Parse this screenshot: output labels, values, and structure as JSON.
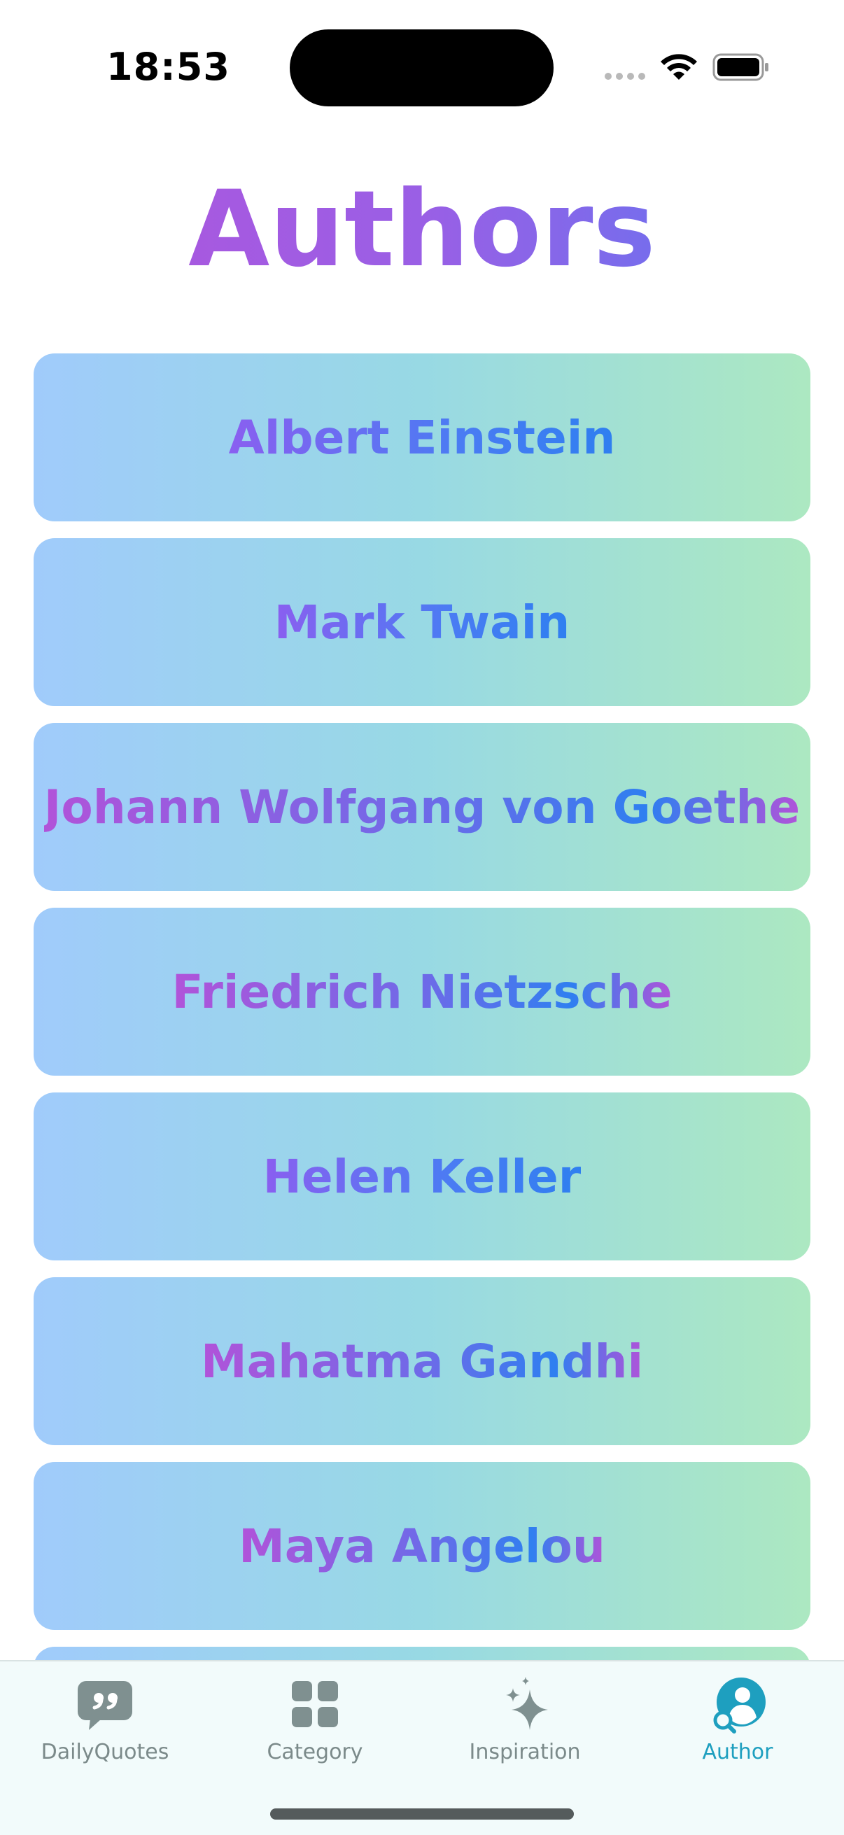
{
  "status_bar": {
    "time": "18:53"
  },
  "title": "Authors",
  "authors": [
    {
      "name": "Albert Einstein"
    },
    {
      "name": "Mark Twain"
    },
    {
      "name": "Johann Wolfgang von Goethe"
    },
    {
      "name": "Friedrich Nietzsche"
    },
    {
      "name": "Helen Keller"
    },
    {
      "name": "Mahatma Gandhi"
    },
    {
      "name": "Maya Angelou"
    }
  ],
  "tabs": [
    {
      "label": "DailyQuotes",
      "icon": "quote-bubble-icon",
      "active": false
    },
    {
      "label": "Category",
      "icon": "grid-icon",
      "active": false
    },
    {
      "label": "Inspiration",
      "icon": "sparkles-icon",
      "active": false
    },
    {
      "label": "Author",
      "icon": "person-search-icon",
      "active": true
    }
  ],
  "colors": {
    "title_gradient_start": "#b154dc",
    "title_gradient_end": "#5a78f2",
    "card_gradient_start": "#a0cbfb",
    "card_gradient_end": "#ace8c1",
    "tab_active": "#1e9fbf",
    "tab_inactive": "#7b8a8a",
    "tab_bar_bg": "#f2fbfb"
  }
}
